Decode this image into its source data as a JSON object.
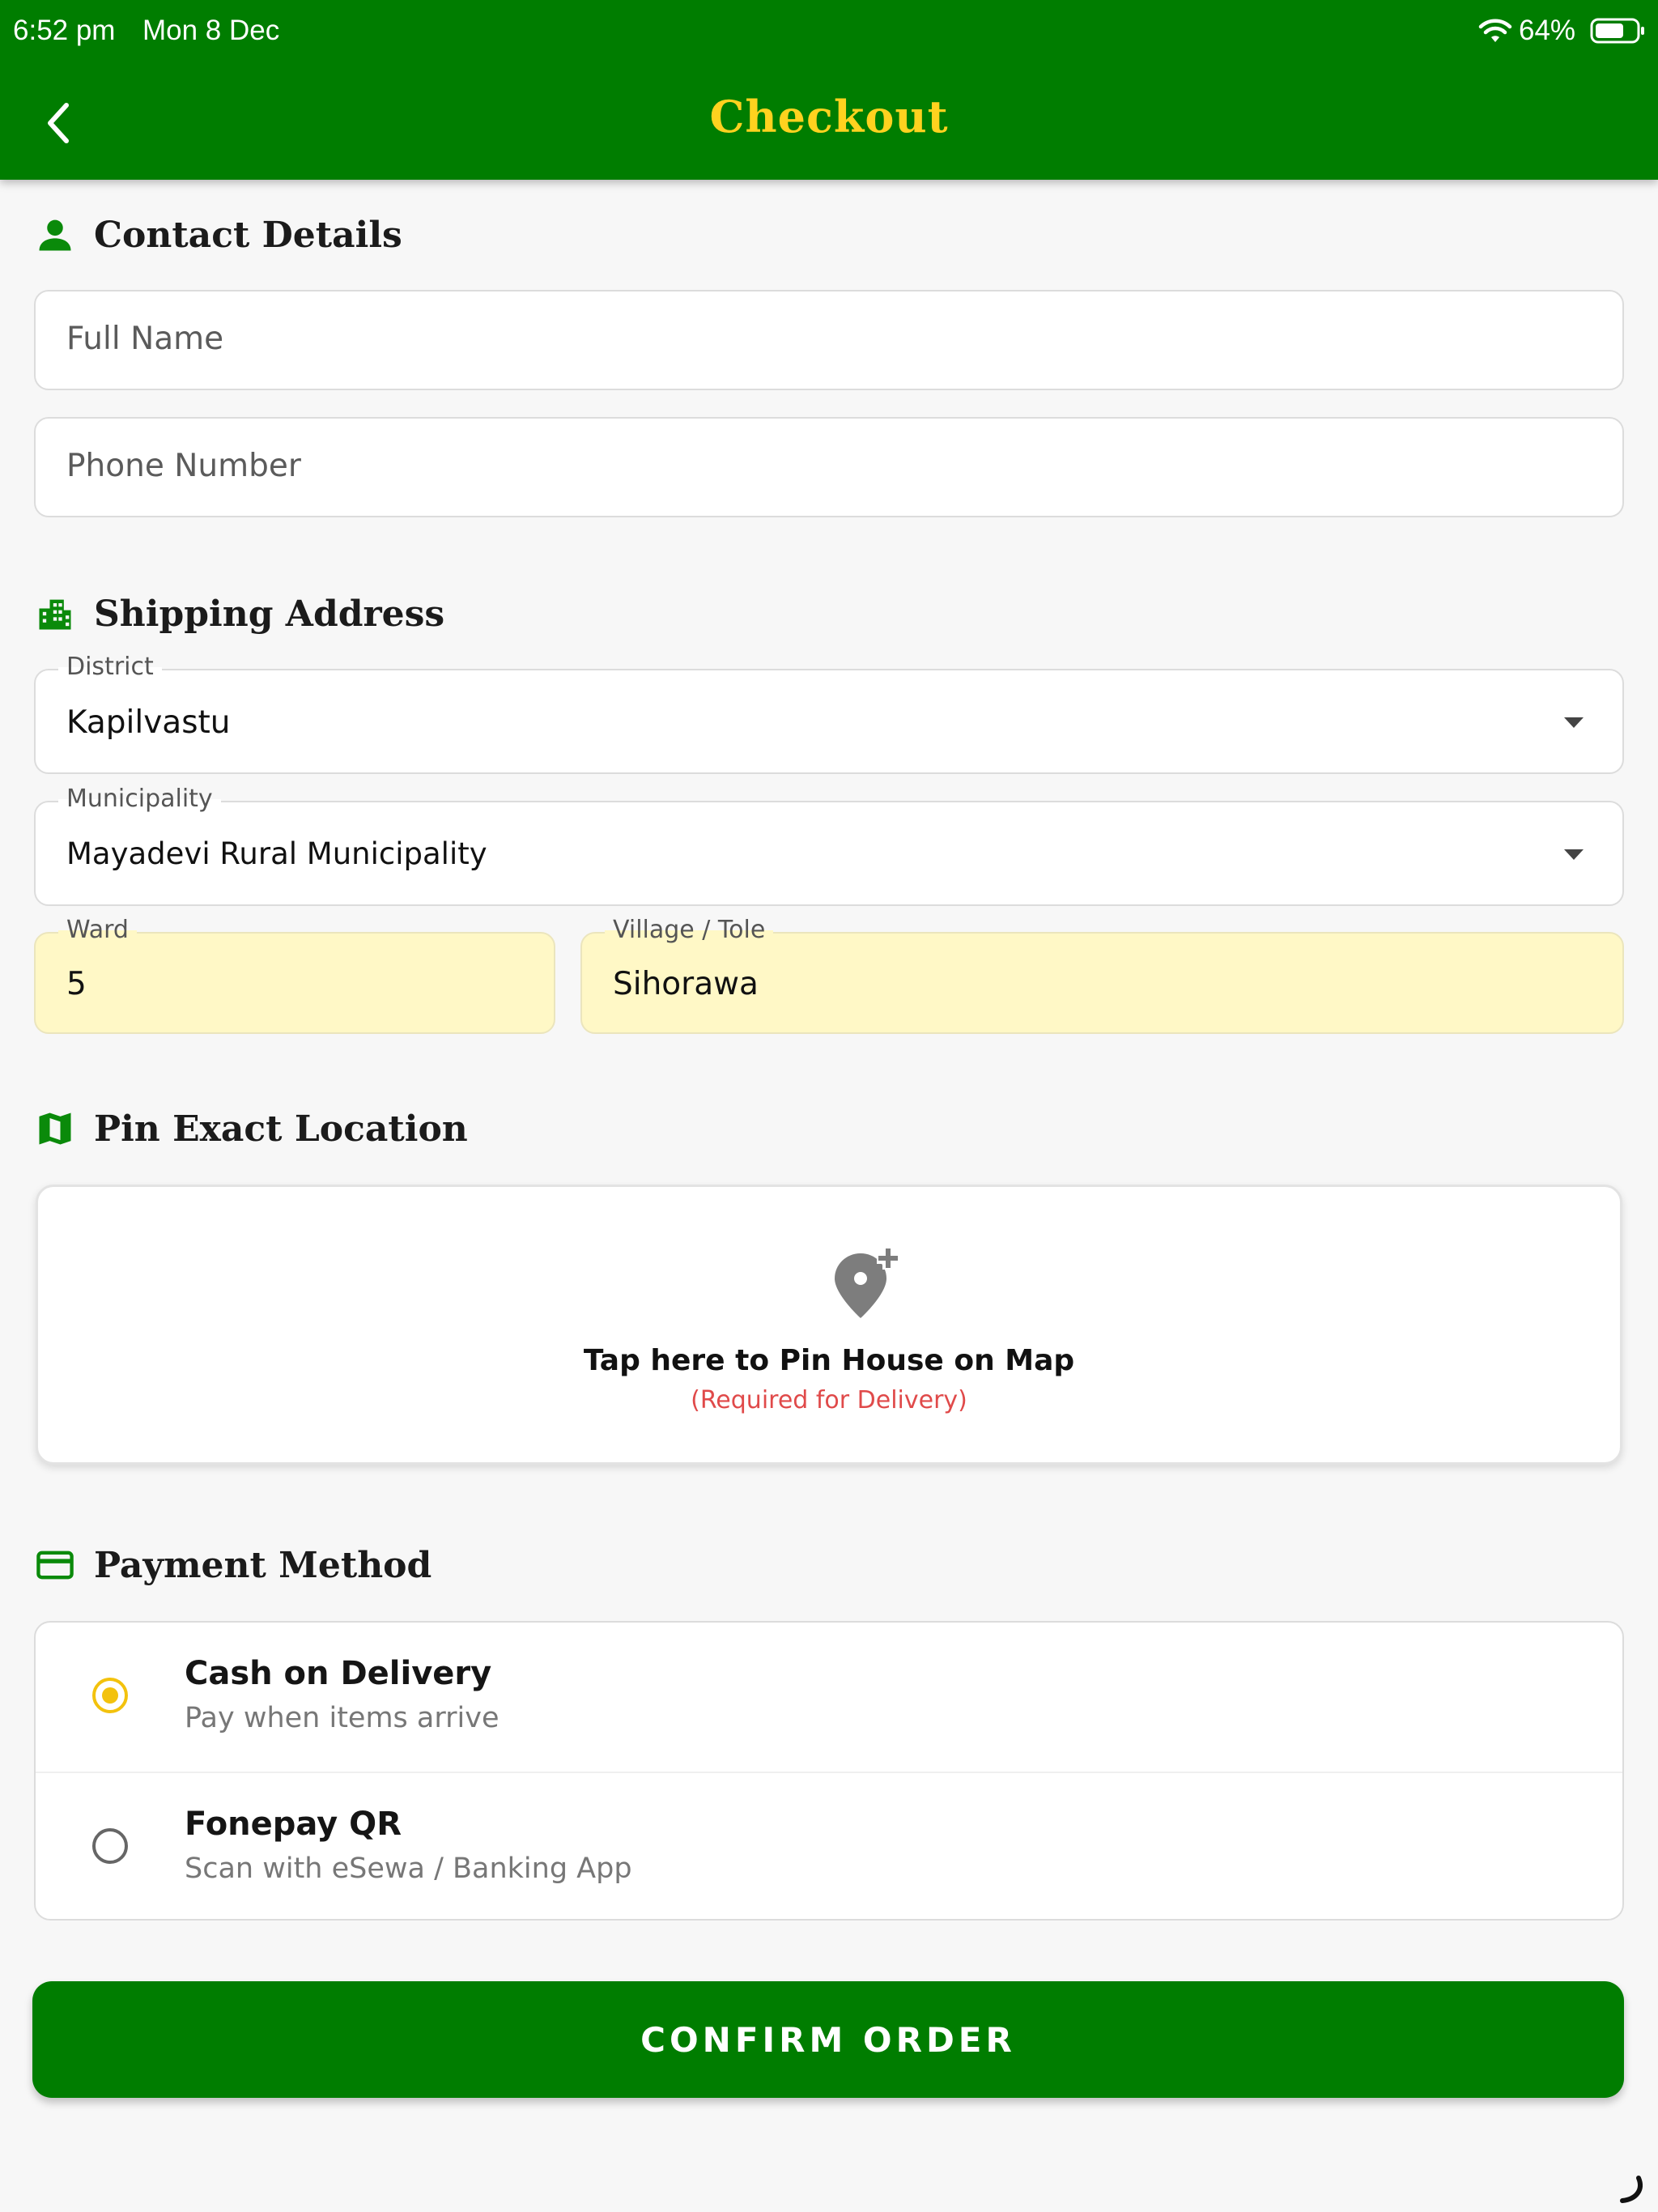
{
  "status_bar": {
    "time": "6:52 pm",
    "date": "Mon 8 Dec",
    "battery": "64%"
  },
  "header": {
    "title": "Checkout"
  },
  "contact": {
    "heading": "Contact Details",
    "full_name_placeholder": "Full Name",
    "phone_placeholder": "Phone Number"
  },
  "shipping": {
    "heading": "Shipping Address",
    "district_label": "District",
    "district_value": "Kapilvastu",
    "municipality_label": "Municipality",
    "municipality_value": "Mayadevi Rural Municipality",
    "ward_label": "Ward",
    "ward_value": "5",
    "village_label": "Village / Tole",
    "village_value": "Sihorawa"
  },
  "location": {
    "heading": "Pin Exact Location",
    "prompt": "Tap here to Pin House on Map",
    "required_note": "(Required for Delivery)"
  },
  "payment": {
    "heading": "Payment Method",
    "options": [
      {
        "title": "Cash on Delivery",
        "subtitle": "Pay when items arrive",
        "selected": true
      },
      {
        "title": "Fonepay QR",
        "subtitle": "Scan with eSewa / Banking App",
        "selected": false
      }
    ]
  },
  "confirm_button": "CONFIRM ORDER",
  "colors": {
    "primary_green": "#007d00",
    "title_yellow": "#ffd21f",
    "highlight_yellow": "#fff8c6",
    "radio_yellow": "#f3c20d",
    "required_red": "#e04a4a"
  },
  "icons": {
    "back": "chevron-left-icon",
    "contact": "person-icon",
    "shipping": "city-icon",
    "location": "map-icon",
    "payment": "credit-card-icon",
    "pin": "add-location-icon"
  }
}
